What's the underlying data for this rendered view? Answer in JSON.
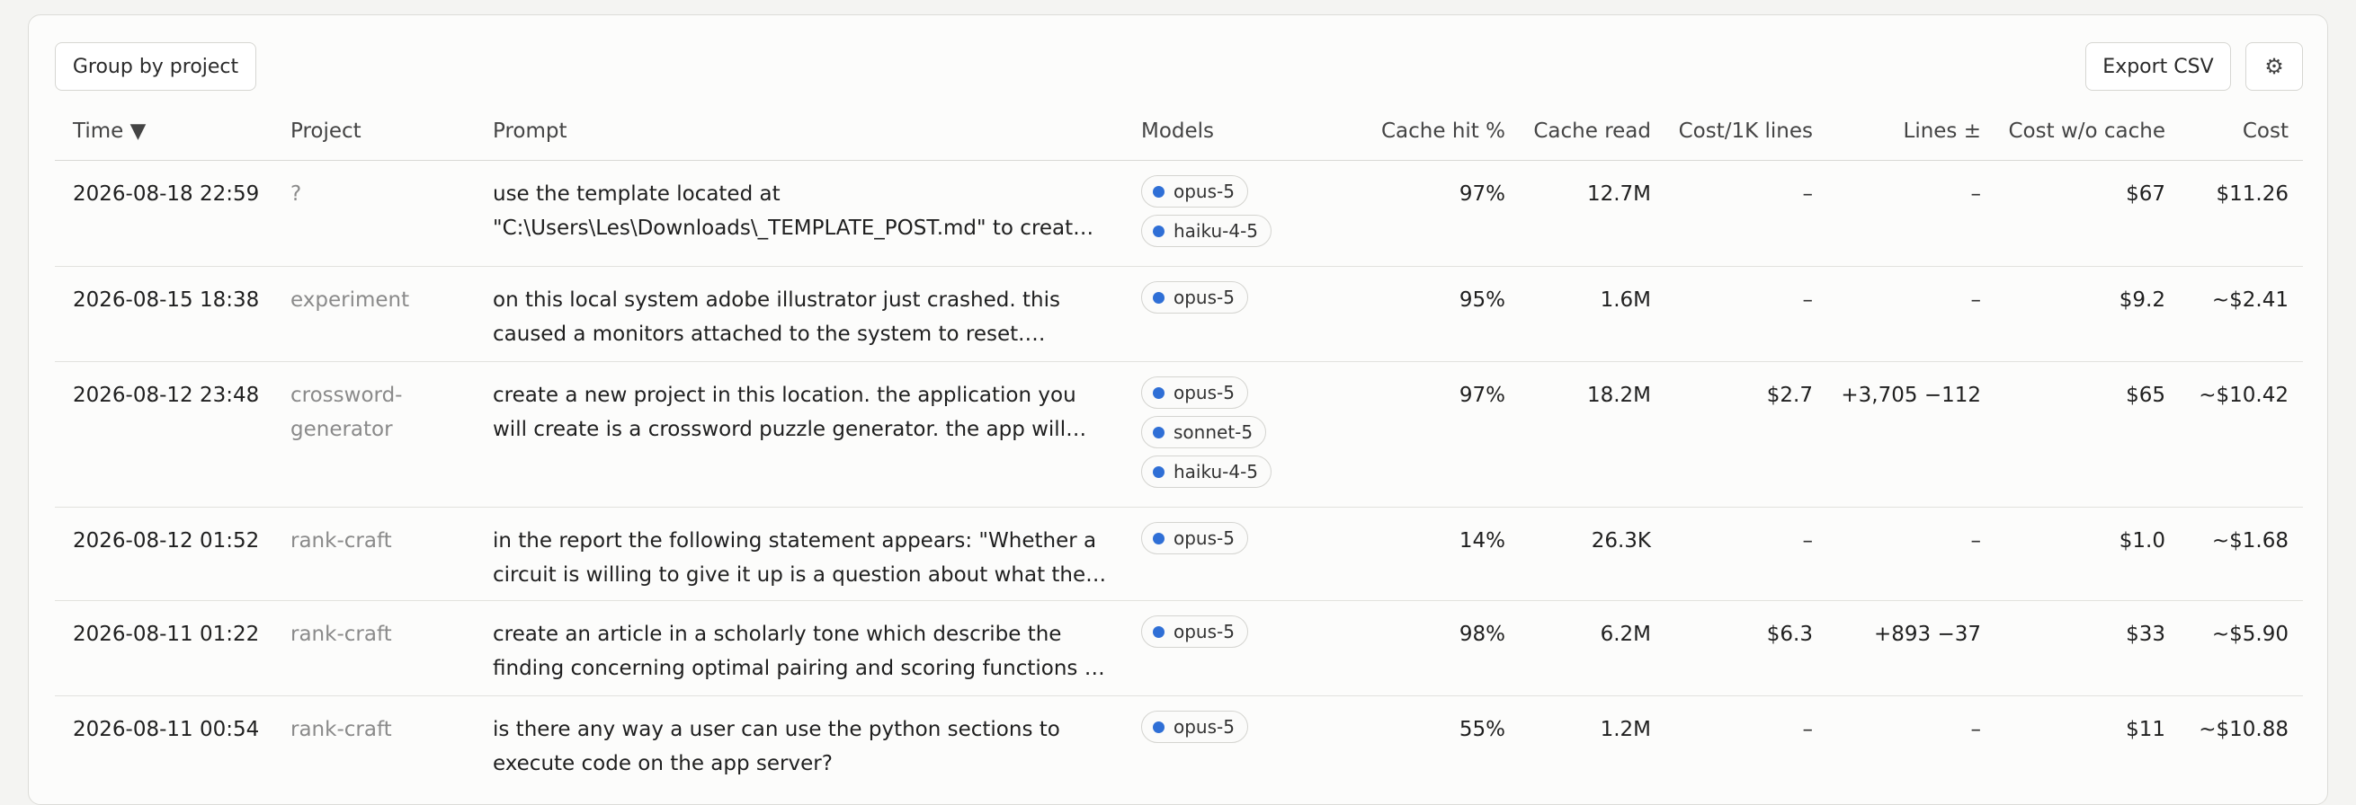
{
  "toolbar": {
    "group_label": "Group by project",
    "export_label": "Export CSV",
    "settings_icon": "⚙"
  },
  "columns": {
    "time": "Time ▼",
    "project": "Project",
    "prompt": "Prompt",
    "models": "Models",
    "cache_hit": "Cache hit %",
    "cache_read": "Cache read",
    "cost_1k": "Cost/1K lines",
    "lines": "Lines ±",
    "cost_wo_cache": "Cost w/o cache",
    "cost": "Cost"
  },
  "rows": [
    {
      "time": "2026-08-18 22:59",
      "project": "?",
      "prompt": [
        "use the template located at",
        "\"C:\\Users\\Les\\Downloads\\_TEMPLATE_POST.md\" to creat…"
      ],
      "models": [
        "opus-5",
        "haiku-4-5"
      ],
      "cache_hit": "97%",
      "cache_read": "12.7M",
      "cost_1k": "–",
      "lines": "–",
      "cost_wo_cache": "$67",
      "cost": "$11.26"
    },
    {
      "time": "2026-08-15 18:38",
      "project": "experiment",
      "prompt": [
        "on this local system adobe illustrator just crashed. this",
        "caused a monitors attached to the system to reset.…"
      ],
      "models": [
        "opus-5"
      ],
      "cache_hit": "95%",
      "cache_read": "1.6M",
      "cost_1k": "–",
      "lines": "–",
      "cost_wo_cache": "$9.2",
      "cost": "~$2.41"
    },
    {
      "time": "2026-08-12 23:48",
      "project": "crossword-generator",
      "project_lines": [
        "crossword-",
        "generator"
      ],
      "prompt": [
        "create a new project in this location. the application you",
        "will create is a crossword puzzle generator. the app will…"
      ],
      "models": [
        "opus-5",
        "sonnet-5",
        "haiku-4-5"
      ],
      "cache_hit": "97%",
      "cache_read": "18.2M",
      "cost_1k": "$2.7",
      "lines": "+3,705 −112",
      "cost_wo_cache": "$65",
      "cost": "~$10.42"
    },
    {
      "time": "2026-08-12 01:52",
      "project": "rank-craft",
      "prompt": [
        "in the report the following statement appears: \"Whether a",
        "circuit is willing to give it up is a question about what the…"
      ],
      "models": [
        "opus-5"
      ],
      "cache_hit": "14%",
      "cache_read": "26.3K",
      "cost_1k": "–",
      "lines": "–",
      "cost_wo_cache": "$1.0",
      "cost": "~$1.68"
    },
    {
      "time": "2026-08-11 01:22",
      "project": "rank-craft",
      "prompt": [
        "create an article in a scholarly tone which describe the",
        "finding concerning optimal pairing and scoring functions …"
      ],
      "models": [
        "opus-5"
      ],
      "cache_hit": "98%",
      "cache_read": "6.2M",
      "cost_1k": "$6.3",
      "lines": "+893 −37",
      "cost_wo_cache": "$33",
      "cost": "~$5.90"
    },
    {
      "time": "2026-08-11 00:54",
      "project": "rank-craft",
      "prompt": [
        "is there any way a user can use the python sections to",
        "execute code on the app server?"
      ],
      "models": [
        "opus-5"
      ],
      "cache_hit": "55%",
      "cache_read": "1.2M",
      "cost_1k": "–",
      "lines": "–",
      "cost_wo_cache": "$11",
      "cost": "~$10.88"
    }
  ],
  "colors": {
    "model_dot": "#2f6fd6",
    "project_text": "#8a8a8a"
  }
}
